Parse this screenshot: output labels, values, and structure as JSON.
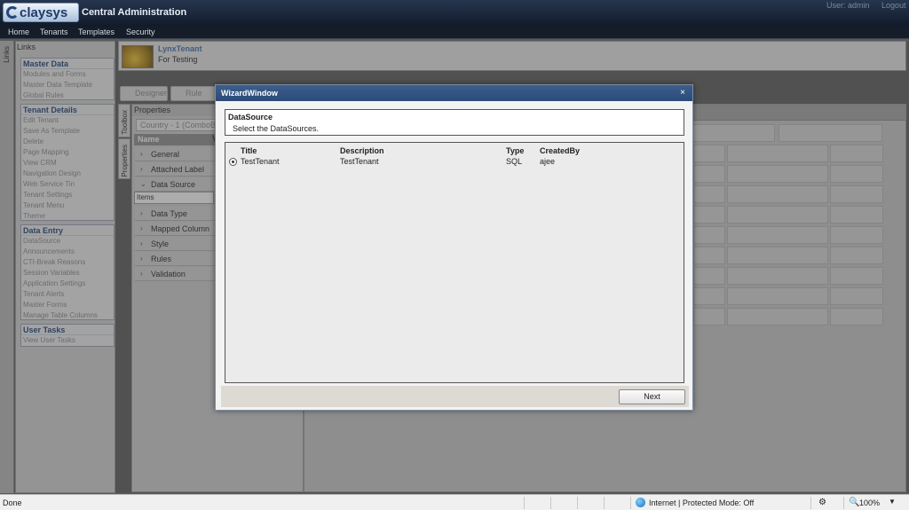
{
  "header": {
    "logo_text": "claysys",
    "app_title": "Central Administration",
    "user_label": "User: admin",
    "logout": "Logout"
  },
  "menu": [
    "Home",
    "Tenants",
    "Templates",
    "Security"
  ],
  "links": {
    "tab_label": "Links",
    "panel_title": "Links",
    "sections": [
      {
        "title": "Master Data",
        "items": [
          "Modules and Forms",
          "Master Data Template",
          "Global Rules"
        ]
      },
      {
        "title": "Tenant Details",
        "items": [
          "Edit Tenant",
          "Save As Template",
          "Delete",
          "Page Mapping",
          "View CRM",
          "Navigation Design",
          "Web Service Tin",
          "Tenant Settings",
          "Tenant Menu",
          "Theme"
        ]
      },
      {
        "title": "Data Entry",
        "items": [
          "DataSource",
          "Announcements",
          "CTI-Break Reasons",
          "Session Variables",
          "Application Settings",
          "Tenant Alerts",
          "Master Forms",
          "Manage Table Columns"
        ]
      },
      {
        "title": "User Tasks",
        "items": [
          "View User Tasks"
        ]
      }
    ]
  },
  "tenant": {
    "name": "LynxTenant",
    "description": "For Testing"
  },
  "toolbar": {
    "designer": "Designer",
    "rule": "Rule"
  },
  "side_tabs": {
    "toolbox": "Toolbox",
    "properties": "Properties"
  },
  "properties": {
    "title": "Properties",
    "combo_value": "Country - 1 (ComboB",
    "name_header": "Name",
    "value_header": "V",
    "items_label": "Items",
    "groups": [
      "General",
      "Attached Label",
      "Data Source",
      "Data Type",
      "Mapped Column",
      "Style",
      "Rules",
      "Validation"
    ]
  },
  "modal": {
    "title": "WizardWindow",
    "close": "×",
    "section_title": "DataSource",
    "section_subtitle": "Select the DataSources.",
    "columns": [
      "Title",
      "Description",
      "Type",
      "CreatedBy"
    ],
    "rows": [
      {
        "title": "TestTenant",
        "description": "TestTenant",
        "type": "SQL",
        "created_by": "ajee",
        "selected": true
      }
    ],
    "next_button": "Next"
  },
  "status": {
    "done": "Done",
    "zone": "Internet | Protected Mode: Off",
    "zoom": "100%"
  }
}
